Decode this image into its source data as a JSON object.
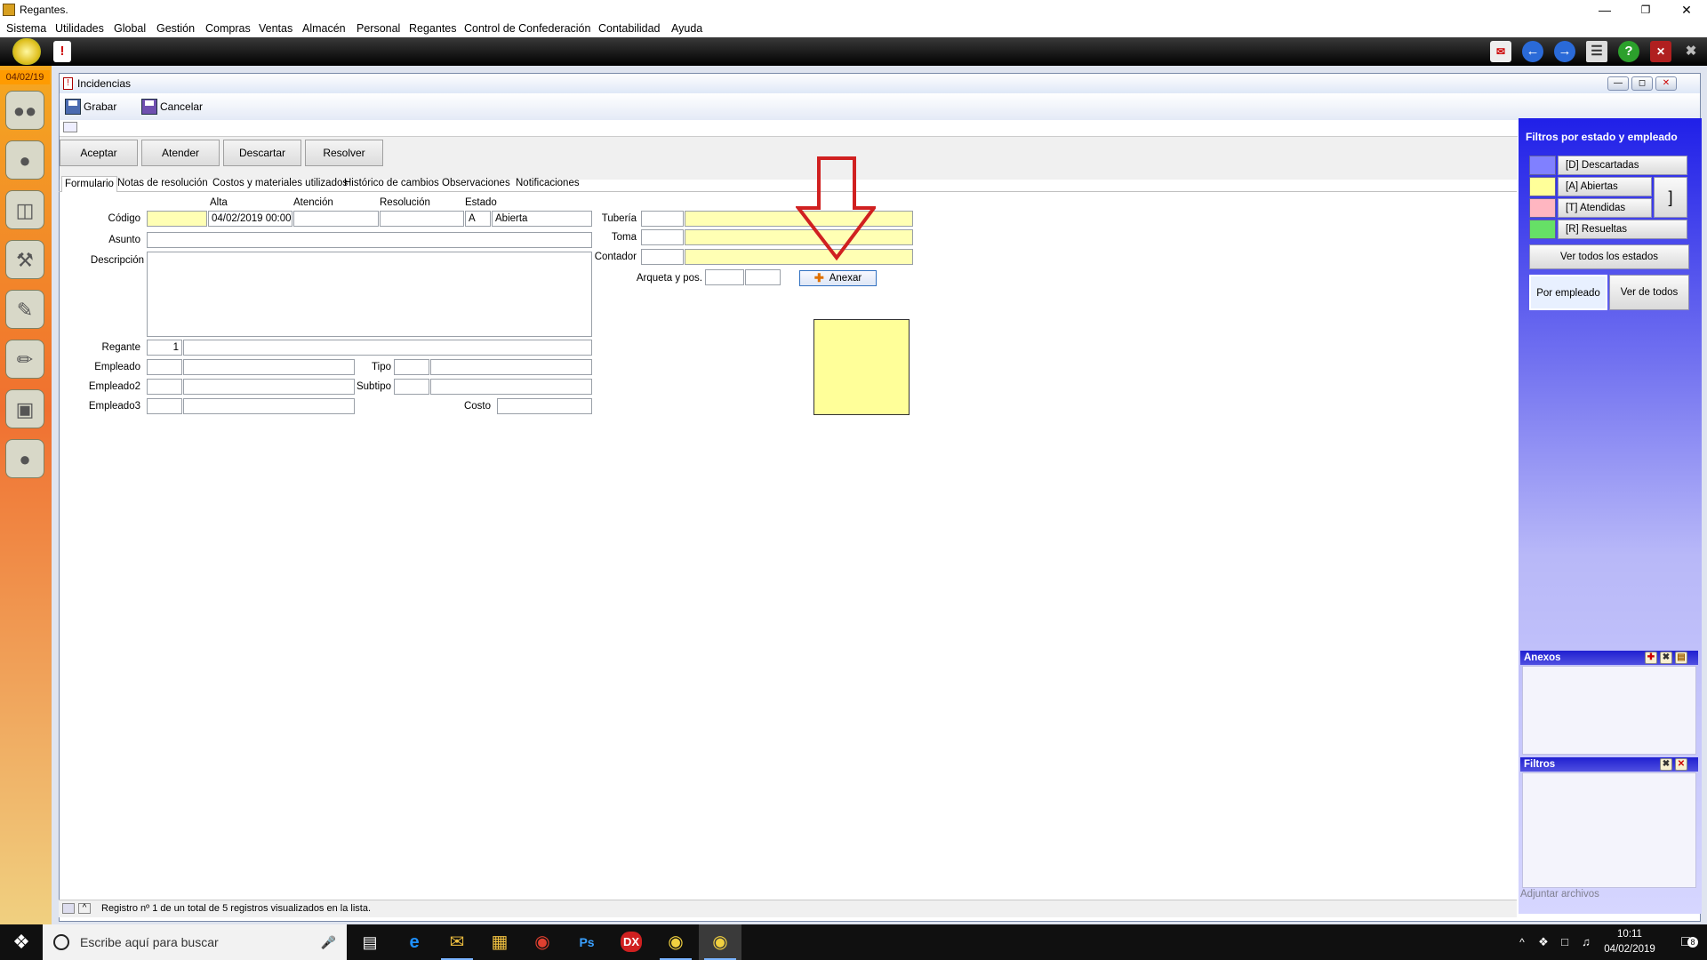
{
  "app": {
    "title": "Regantes."
  },
  "menu": [
    "Sistema",
    "Utilidades",
    "Global",
    "Gestión",
    "Compras",
    "Ventas",
    "Almacén",
    "Personal",
    "Regantes",
    "Control de Confederación",
    "Contabilidad",
    "Ayuda"
  ],
  "sidebar": {
    "date": "04/02/19"
  },
  "window": {
    "title": "Incidencias",
    "save_label": "Grabar",
    "cancel_label": "Cancelar"
  },
  "actions": {
    "accept": "Aceptar",
    "attend": "Atender",
    "discard": "Descartar",
    "resolve": "Resolver"
  },
  "tabs": [
    "Formulario",
    "Notas de resolución",
    "Costos y materiales utilizados",
    "Histórico de cambios",
    "Observaciones",
    "Notificaciones"
  ],
  "form": {
    "col_headers": {
      "alta": "Alta",
      "atencion": "Atención",
      "resolucion": "Resolución",
      "estado": "Estado"
    },
    "labels": {
      "codigo": "Código",
      "asunto": "Asunto",
      "descripcion": "Descripción",
      "regante": "Regante",
      "empleado": "Empleado",
      "empleado2": "Empleado2",
      "empleado3": "Empleado3",
      "tipo": "Tipo",
      "subtipo": "Subtipo",
      "costo": "Costo",
      "tuberia": "Tubería",
      "toma": "Toma",
      "contador": "Contador",
      "arqueta": "Arqueta y pos."
    },
    "values": {
      "codigo": "",
      "alta": "04/02/2019 00:00",
      "estado_code": "A",
      "estado_name": "Abierta",
      "regante_code": "1"
    },
    "attach_label": "Anexar"
  },
  "right_panel": {
    "title": "Filtros por estado y empleado",
    "filters": [
      {
        "label": "[D] Descartadas",
        "color": "#8080ff"
      },
      {
        "label": "[A] Abiertas",
        "color": "#ffff99"
      },
      {
        "label": "[T] Atendidas",
        "color": "#ffb6c1"
      },
      {
        "label": "[R] Resueltas",
        "color": "#66e066"
      }
    ],
    "all_states": "Ver todos los estados",
    "by_employee": "Por empleado",
    "see_all": "Ver de todos",
    "annexes_title": "Anexos",
    "filters_title": "Filtros",
    "attach_files": "Adjuntar archivos"
  },
  "status": {
    "text": "Registro nº 1 de un total de 5 registros visualizados en la lista."
  },
  "taskbar": {
    "search_placeholder": "Escribe aquí para buscar",
    "time": "10:11",
    "date": "04/02/2019",
    "notif_count": "8"
  }
}
